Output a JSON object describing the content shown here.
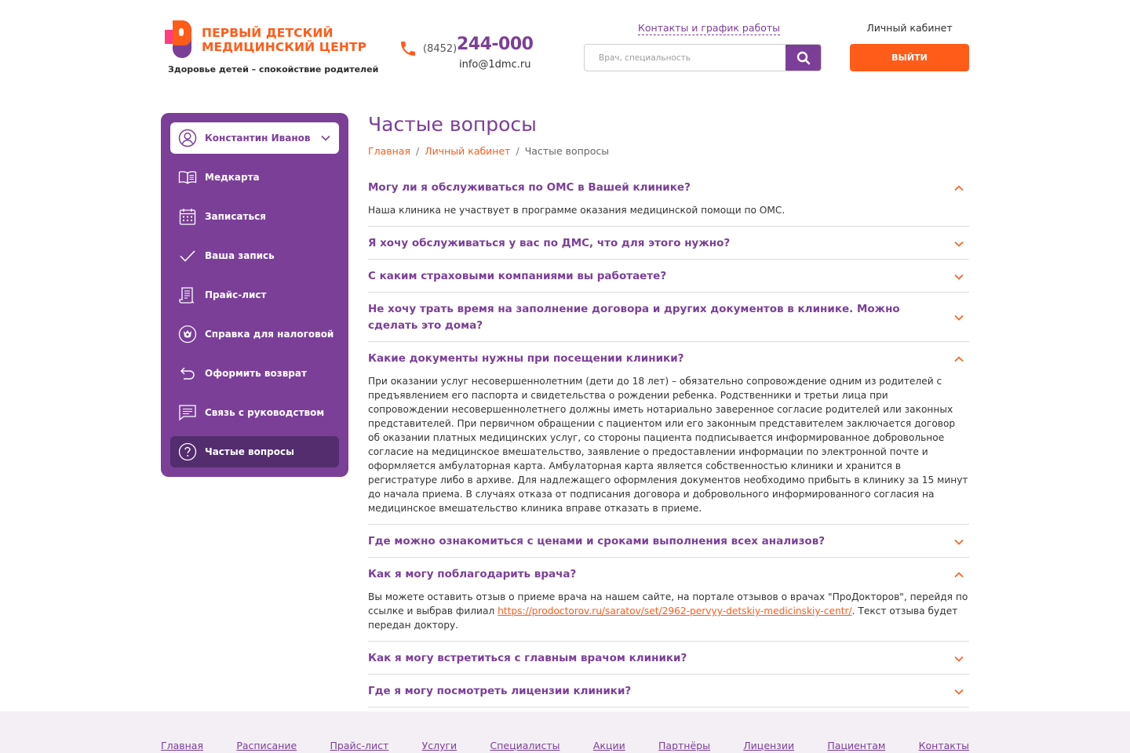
{
  "brand": {
    "title_line1": "ПЕРВЫЙ ДЕТСКИЙ",
    "title_line2": "МЕДИЦИНСКИЙ ЦЕНТР",
    "tagline": "Здоровье детей – спокойствие родителей"
  },
  "header": {
    "phone_code": "(8452)",
    "phone_number": "244-000",
    "email": "info@1dmc.ru",
    "contacts_link": "Контакты и график работы",
    "search_placeholder": "Врач, специальность",
    "cabinet_label": "Личный кабинет",
    "logout_label": "ВЫЙТИ"
  },
  "sidebar": {
    "user_name": "Константин Иванов",
    "items": [
      {
        "label": "Медкарта",
        "icon": "book-icon"
      },
      {
        "label": "Записаться",
        "icon": "calendar-icon"
      },
      {
        "label": "Ваша запись",
        "icon": "check-icon"
      },
      {
        "label": "Прайс-лист",
        "icon": "price-list-icon"
      },
      {
        "label": "Справка для налоговой",
        "icon": "tax-emblem-icon"
      },
      {
        "label": "Оформить возврат",
        "icon": "return-arrow-icon"
      },
      {
        "label": "Связь с руководством",
        "icon": "message-icon"
      },
      {
        "label": "Частые вопросы",
        "icon": "question-icon"
      }
    ],
    "active_index": 7
  },
  "page": {
    "title": "Частые вопросы",
    "breadcrumb": [
      "Главная",
      "Личный кабинет",
      "Частые вопросы"
    ]
  },
  "faq": [
    {
      "q": "Могу ли я обслуживаться по ОМС в Вашей клинике?",
      "open": true,
      "a": "Наша клиника не участвует в программе оказания медицинской помощи по ОМС."
    },
    {
      "q": "Я хочу обслуживаться у вас по ДМС, что для этого нужно?",
      "open": false
    },
    {
      "q": "С каким страховыми компаниями вы работаете?",
      "open": false
    },
    {
      "q": "Не хочу трать время на заполнение договора и других документов в клинике. Можно сделать это дома?",
      "open": false
    },
    {
      "q": "Какие документы нужны при посещении клиники?",
      "open": true,
      "a": "При оказании услуг несовершеннолетним (дети до 18 лет) – обязательно сопровождение одним из родителей с предъявлением его паспорта и свидетельства о рождении ребенка. Родственники и третьи лица при сопровождении несовершеннолетнего должны иметь нотариально заверенное согласие родителей или законных представителей. При первичном обращении с пациентом или его законным представителем заключается договор об оказании платных медицинских услуг, со стороны пациента подписывается информированное добровольное согласие на медицинское вмешательство, заявление о предоставлении информации по электронной почте и оформляется амбулаторная карта. Амбулаторная карта является собственностью клиники и хранится в регистратуре либо в архиве. Для надлежащего оформления документов необходимо прибыть в клинику за 15 минут до начала приема. В случаях отказа от подписания договора и добровольного информированного согласия на медицинское вмешательство клиника вправе отказать в приеме."
    },
    {
      "q": "Где можно ознакомиться с ценами и сроками выполнения всех анализов?",
      "open": false
    },
    {
      "q": "Как я могу поблагодарить врача?",
      "open": true,
      "a_before": "Вы можете оставить отзыв о приеме врача на нашем сайте, на портале отзывов о врачах \"ПроДокторов\", перейдя по ссылке и выбрав филиал ",
      "a_link": "https://prodoctorov.ru/saratov/set/2962-pervyy-detskiy-medicinskiy-centr/",
      "a_after": ". Текст отзыва будет передан доктору."
    },
    {
      "q": "Как я могу встретиться с главным врачом клиники?",
      "open": false
    },
    {
      "q": "Где я могу посмотреть лицензии клиники?",
      "open": false
    }
  ],
  "footer": {
    "links": [
      "Главная",
      "Расписание",
      "Прайс-лист",
      "Услуги",
      "Специалисты",
      "Акции",
      "Партнёры",
      "Лицензии",
      "Пациентам",
      "Контакты"
    ]
  },
  "colors": {
    "brand_purple": "#7b3f98",
    "brand_orange": "#ff5c1a",
    "active_nav": "#532d6e",
    "footer_bg": "#f4eff5"
  }
}
